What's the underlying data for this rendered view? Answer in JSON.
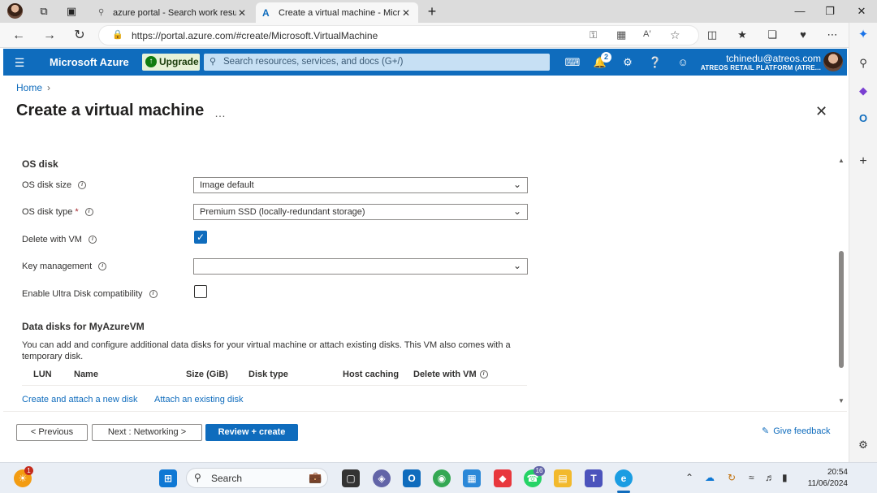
{
  "browser": {
    "tabs": [
      {
        "title": "azure portal - Search work result"
      },
      {
        "title": "Create a virtual machine - Micro"
      }
    ],
    "url": "https://portal.azure.com/#create/Microsoft.VirtualMachine"
  },
  "azure": {
    "brand": "Microsoft Azure",
    "upgrade_label": "Upgrade",
    "search_placeholder": "Search resources, services, and docs (G+/)",
    "notifications_count": "2",
    "account_email": "tchinedu@atreos.com",
    "account_org": "ATREOS RETAIL PLATFORM (ATRE..."
  },
  "page": {
    "breadcrumb_home": "Home",
    "title": "Create a virtual machine",
    "ellipsis": "…"
  },
  "os_disk": {
    "section_title": "OS disk",
    "size_label": "OS disk size",
    "size_value": "Image default",
    "type_label": "OS disk type",
    "type_required": "*",
    "type_value": "Premium SSD (locally-redundant storage)",
    "delete_label": "Delete with VM",
    "delete_checked": true,
    "key_label": "Key management",
    "key_value": "",
    "ultra_label": "Enable Ultra Disk compatibility",
    "ultra_checked": false
  },
  "data_disks": {
    "section_title": "Data disks for MyAzureVM",
    "description": "You can add and configure additional data disks for your virtual machine or attach existing disks. This VM also comes with a temporary disk.",
    "columns": [
      "LUN",
      "Name",
      "Size (GiB)",
      "Disk type",
      "Host caching",
      "Delete with VM"
    ],
    "create_link": "Create and attach a new disk",
    "attach_link": "Attach an existing disk"
  },
  "footer": {
    "previous": "< Previous",
    "next": "Next : Networking >",
    "review": "Review + create",
    "feedback": "Give feedback"
  },
  "taskbar": {
    "search_label": "Search",
    "whatsapp_badge": "16",
    "weather_badge": "1",
    "time": "20:54",
    "date": "11/06/2024"
  },
  "colors": {
    "azure_blue": "#0f6cbd",
    "link_blue": "#0f6cbd",
    "required_red": "#a4262c"
  }
}
